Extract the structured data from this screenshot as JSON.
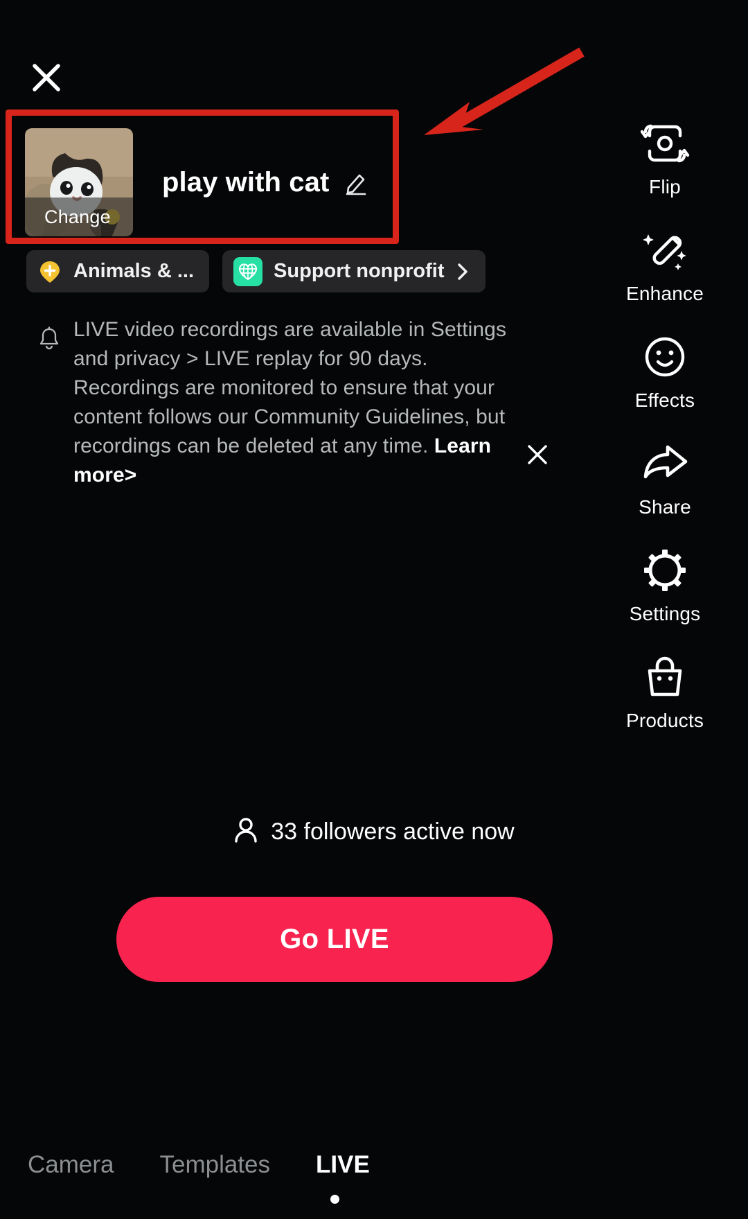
{
  "app": {
    "screen_name": "TikTok LIVE setup",
    "background_color": "#050607"
  },
  "header": {
    "close_icon": "close-icon"
  },
  "annotation": {
    "rect_color": "#d8251c",
    "arrow_color": "#d8251c",
    "arrow_icon": "arrow-pointing-left-down"
  },
  "stream": {
    "title": "play with cat",
    "edit_icon": "pencil-icon",
    "cover_change_label": "Change",
    "cover_alt": "kitten photo thumbnail"
  },
  "chips": [
    {
      "label": "Animals & ...",
      "icon": "location-pin-plus-icon",
      "icon_color": "#f5c232",
      "has_chevron": false
    },
    {
      "label": "Support nonprofit",
      "icon": "heart-globe-icon",
      "icon_color": "#27e0a4",
      "has_chevron": true
    }
  ],
  "notice": {
    "icon": "bell-icon",
    "text": "LIVE video recordings are available in Settings and privacy > LIVE replay for 90 days. Recordings are monitored to ensure that your content follows our Community Guidelines, but recordings can be deleted at any time. ",
    "link_label": "Learn more>",
    "close_icon": "close-icon"
  },
  "right_rail": [
    {
      "label": "Flip",
      "icon": "camera-flip-icon"
    },
    {
      "label": "Enhance",
      "icon": "magic-wand-icon"
    },
    {
      "label": "Effects",
      "icon": "smiley-face-icon"
    },
    {
      "label": "Share",
      "icon": "share-arrow-icon"
    },
    {
      "label": "Settings",
      "icon": "gear-icon"
    },
    {
      "label": "Products",
      "icon": "shopping-bag-icon"
    }
  ],
  "followers": {
    "icon": "person-icon",
    "text": "33 followers active now",
    "count": 33
  },
  "go_live": {
    "label": "Go LIVE",
    "color": "#f8234f"
  },
  "tabs": [
    {
      "label": "Camera",
      "active": false
    },
    {
      "label": "Templates",
      "active": false
    },
    {
      "label": "LIVE",
      "active": true
    }
  ]
}
